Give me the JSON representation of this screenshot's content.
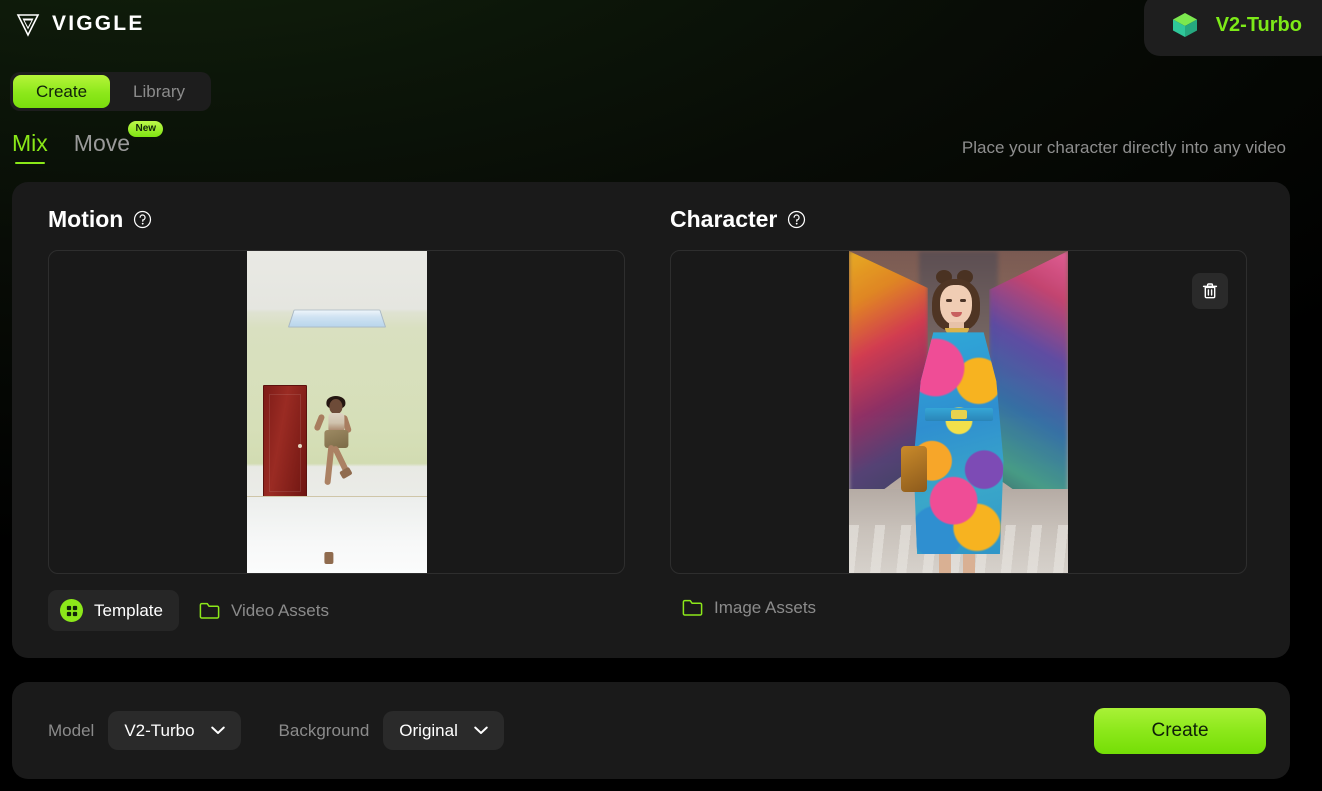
{
  "brand": {
    "name": "VIGGLE",
    "logo_icon": "viggle-v-logo"
  },
  "header": {
    "model_pill": {
      "label": "V2-Turbo",
      "icon": "cube-icon",
      "accent": "#7dea18"
    }
  },
  "nav": {
    "segments": [
      {
        "label": "Create",
        "active": true
      },
      {
        "label": "Library",
        "active": false
      }
    ]
  },
  "subtabs": {
    "items": [
      {
        "label": "Mix",
        "active": true,
        "badge": null
      },
      {
        "label": "Move",
        "active": false,
        "badge": "New"
      }
    ],
    "hint": "Place your character directly into any video"
  },
  "motion": {
    "title": "Motion",
    "help_icon": "question-circle-icon",
    "thumbnail_alt": "dancer in room with red door and yellow-green walls",
    "assets": [
      {
        "label": "Template",
        "icon": "grid-icon",
        "selected": true
      },
      {
        "label": "Video Assets",
        "icon": "folder-icon",
        "selected": false
      }
    ]
  },
  "character": {
    "title": "Character",
    "help_icon": "question-circle-icon",
    "thumbnail_alt": "woman in colorful patterned dress standing in graffiti alley",
    "delete_icon": "trash-icon",
    "assets": [
      {
        "label": "Image Assets",
        "icon": "folder-icon",
        "selected": false
      }
    ]
  },
  "bottom_bar": {
    "model_label": "Model",
    "model_value": "V2-Turbo",
    "background_label": "Background",
    "background_value": "Original",
    "create_label": "Create",
    "chevron_icon": "chevron-down-icon"
  },
  "colors": {
    "accent_green": "#8ce81a",
    "panel": "#1a1a1a",
    "panel_alt": "#2a2a2a",
    "text_muted": "#8b8b8b"
  }
}
